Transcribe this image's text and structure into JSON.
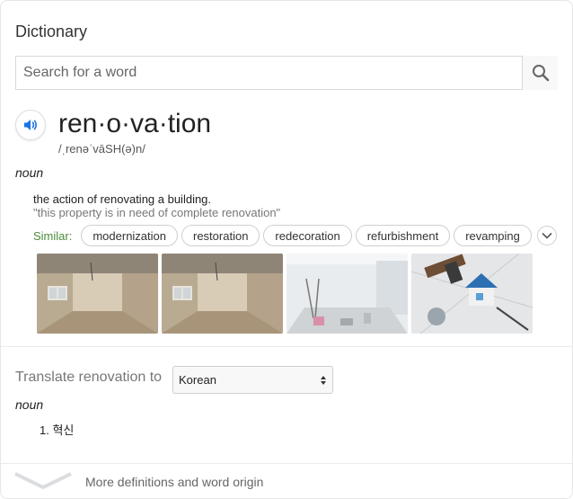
{
  "header": {
    "title": "Dictionary"
  },
  "search": {
    "placeholder": "Search for a word",
    "button_icon": "search-icon"
  },
  "entry": {
    "word": "ren·o·va·tion",
    "phonetic": "/ˌrenəˈvāSH(ə)n/",
    "audio_icon": "speaker-icon",
    "part_of_speech": "noun",
    "definition": "the action of renovating a building.",
    "example": "\"this property is in need of complete renovation\"",
    "similar_label": "Similar:",
    "similar": [
      "modernization",
      "restoration",
      "redecoration",
      "refurbishment",
      "revamping"
    ],
    "images": [
      "renovated-room-image",
      "renovated-room-image",
      "white-room-renovation-image",
      "house-model-tools-image"
    ]
  },
  "translate": {
    "label": "Translate renovation to",
    "selected_language": "Korean",
    "part_of_speech": "noun",
    "items": [
      "1. 혁신"
    ]
  },
  "footer": {
    "more_label": "More definitions and word origin",
    "icon": "chevron-down-icon"
  },
  "colors": {
    "similar_label": "#4b8d3b",
    "speaker": "#1a73e8",
    "border": "#d9d9d9"
  }
}
